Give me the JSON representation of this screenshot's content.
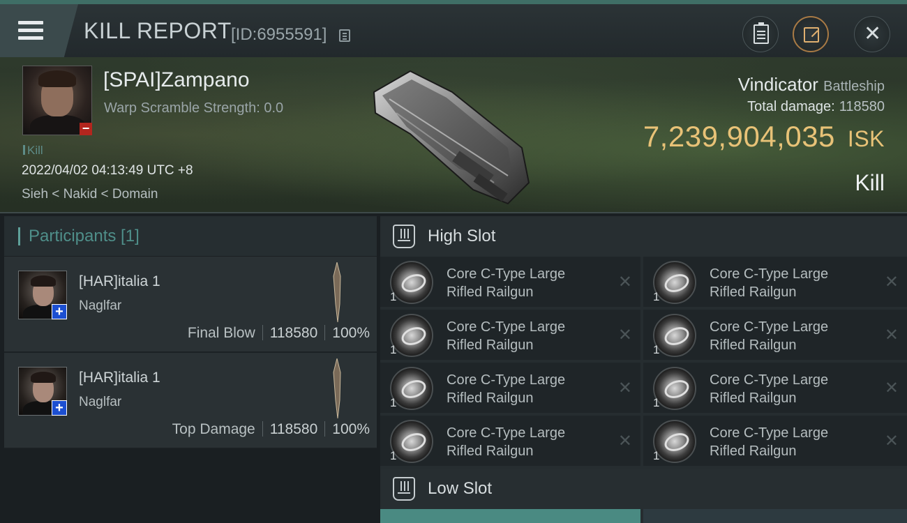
{
  "header": {
    "title": "KILL REPORT",
    "report_id": "[ID:6955591]"
  },
  "victim": {
    "name": "[SPAI]Zampano",
    "warp_scramble": "Warp Scramble Strength: 0.0",
    "tag": "Kill",
    "datetime": "2022/04/02 04:13:49 UTC +8",
    "location": "Sieh < Nakid < Domain",
    "ship": "Vindicator",
    "ship_class": "Battleship",
    "total_damage_label": "Total damage:",
    "total_damage": "118580",
    "isk_value": "7,239,904,035",
    "isk_unit": "ISK",
    "result": "Kill"
  },
  "participants": {
    "label": "Participants [1]",
    "rows": [
      {
        "name": "[HAR]italia 1",
        "ship": "Naglfar",
        "role": "Final Blow",
        "damage": "118580",
        "percent": "100%"
      },
      {
        "name": "[HAR]italia 1",
        "ship": "Naglfar",
        "role": "Top Damage",
        "damage": "118580",
        "percent": "100%"
      }
    ]
  },
  "slots": {
    "high_label": "High Slot",
    "low_label": "Low Slot",
    "modules": [
      {
        "name": "Core C-Type Large Rifled Railgun",
        "qty": "1"
      },
      {
        "name": "Core C-Type Large Rifled Railgun",
        "qty": "1"
      },
      {
        "name": "Core C-Type Large Rifled Railgun",
        "qty": "1"
      },
      {
        "name": "Core C-Type Large Rifled Railgun",
        "qty": "1"
      },
      {
        "name": "Core C-Type Large Rifled Railgun",
        "qty": "1"
      },
      {
        "name": "Core C-Type Large Rifled Railgun",
        "qty": "1"
      },
      {
        "name": "Core C-Type Large Rifled Railgun",
        "qty": "1"
      },
      {
        "name": "Core C-Type Large Rifled Railgun",
        "qty": "1"
      }
    ]
  },
  "colors": {
    "accent_teal": "#5fa09a",
    "isk_gold": "#e8c277",
    "share_border": "#a87a45",
    "badge_red": "#b3261e",
    "badge_blue": "#1c4fd1"
  }
}
